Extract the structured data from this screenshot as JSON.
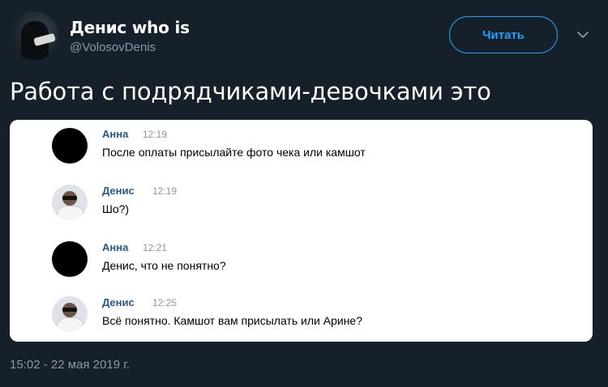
{
  "author": {
    "name": "Денис who is",
    "handle": "@VolosovDenis"
  },
  "follow_button": "Читать",
  "icons": {
    "caret": "chevron-down-icon",
    "author_avatar": "avatar",
    "anna_avatar": "black-circle-avatar",
    "denis_avatar": "man-in-sunglasses-avatar"
  },
  "tweet_text": "Работа с подрядчиками-девочками это",
  "chat": {
    "messages": [
      {
        "name": "Анна",
        "time": "12:19",
        "text": "После оплаты присылайте фото чека или камшот"
      },
      {
        "name": "Денис",
        "time": "12:19",
        "text": "Шо?)"
      },
      {
        "name": "Анна",
        "time": "12:21",
        "text": "Денис, что не понятно?"
      },
      {
        "name": "Денис",
        "time": "12:25",
        "text": "Всё понятно. Камшот вам присылать или Арине?"
      }
    ]
  },
  "timestamp": "15:02 - 22 мая 2019 г.",
  "colors": {
    "background": "#15202b",
    "accent": "#1da1f2",
    "secondary_text": "#8899a6",
    "chat_name": "#2a5885"
  }
}
